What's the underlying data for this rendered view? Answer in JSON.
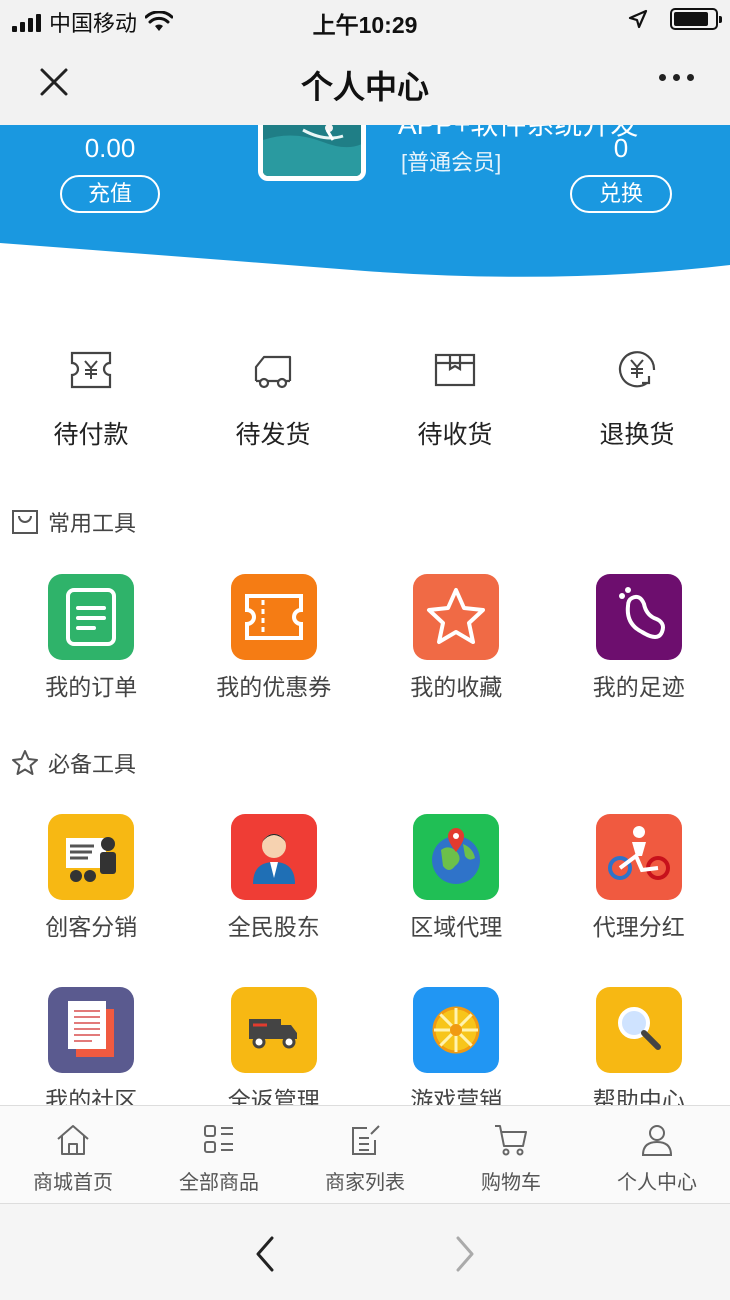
{
  "status_bar": {
    "carrier": "中国移动",
    "time": "上午10:29"
  },
  "header": {
    "title": "个人中心"
  },
  "profile": {
    "shop_name": "APP+软件系统开发",
    "member_level": "[普通会员]",
    "balance": "0.00",
    "recharge_label": "充值",
    "points": "0",
    "redeem_label": "兑换",
    "accent_color": "#1a98e0"
  },
  "orders": [
    {
      "label": "待付款",
      "icon": "pending-payment-icon"
    },
    {
      "label": "待发货",
      "icon": "pending-shipment-icon"
    },
    {
      "label": "待收货",
      "icon": "pending-receipt-icon"
    },
    {
      "label": "退换货",
      "icon": "return-exchange-icon"
    }
  ],
  "common_tools": {
    "title": "常用工具",
    "items": [
      {
        "label": "我的订单",
        "icon": "order-icon",
        "color": "#2fb36a"
      },
      {
        "label": "我的优惠券",
        "icon": "coupon-icon",
        "color": "#f57c14"
      },
      {
        "label": "我的收藏",
        "icon": "star-icon",
        "color": "#f06a45"
      },
      {
        "label": "我的足迹",
        "icon": "footprint-icon",
        "color": "#6d0e6e"
      }
    ]
  },
  "essential_tools": {
    "title": "必备工具",
    "items": [
      {
        "label": "创客分销",
        "icon": "presenter-icon",
        "color": "#f7b813"
      },
      {
        "label": "全民股东",
        "icon": "person-icon",
        "color": "#ef3d35"
      },
      {
        "label": "区域代理",
        "icon": "globe-icon",
        "color": "#20bf55"
      },
      {
        "label": "代理分红",
        "icon": "bike-rider-icon",
        "color": "#f05a40"
      },
      {
        "label": "我的社区",
        "icon": "document-icon",
        "color": "#5a5a8f"
      },
      {
        "label": "全返管理",
        "icon": "truck-icon",
        "color": "#f7b813"
      },
      {
        "label": "游戏营销",
        "icon": "wheel-icon",
        "color": "#2196f3"
      },
      {
        "label": "帮助中心",
        "icon": "magnifier-icon",
        "color": "#f7b813"
      }
    ]
  },
  "tabs": [
    {
      "label": "商城首页",
      "icon": "home-icon"
    },
    {
      "label": "全部商品",
      "icon": "grid-list-icon"
    },
    {
      "label": "商家列表",
      "icon": "edit-list-icon"
    },
    {
      "label": "购物车",
      "icon": "cart-icon"
    },
    {
      "label": "个人中心",
      "icon": "user-icon"
    }
  ]
}
